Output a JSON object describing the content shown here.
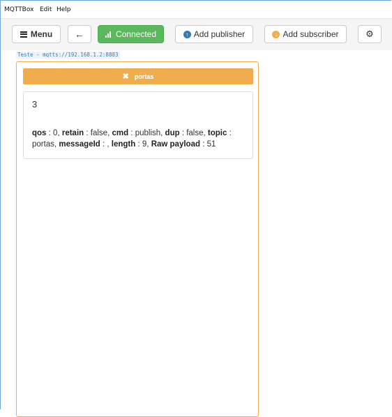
{
  "menubar": {
    "items": [
      "MQTTBox",
      "Edit",
      "Help"
    ]
  },
  "toolbar": {
    "menu_label": "Menu",
    "connected_label": "Connected",
    "add_publisher_label": "Add publisher",
    "add_subscriber_label": "Add subscriber"
  },
  "connection": {
    "label": "Teste - mqtts://192.168.1.2:8883"
  },
  "subscriber": {
    "topic": "portas",
    "message": {
      "payload": "3",
      "fields": [
        {
          "key": "qos",
          "value": "0"
        },
        {
          "key": "retain",
          "value": "false"
        },
        {
          "key": "cmd",
          "value": "publish"
        },
        {
          "key": "dup",
          "value": "false"
        },
        {
          "key": "topic",
          "value": "portas"
        },
        {
          "key": "messageId",
          "value": ""
        },
        {
          "key": "length",
          "value": "9"
        },
        {
          "key": "Raw payload",
          "value": "51"
        }
      ]
    }
  },
  "colors": {
    "connected": "#5cb85c",
    "subscriber_accent": "#f0ad4e",
    "publisher_icon": "#337ab7"
  }
}
